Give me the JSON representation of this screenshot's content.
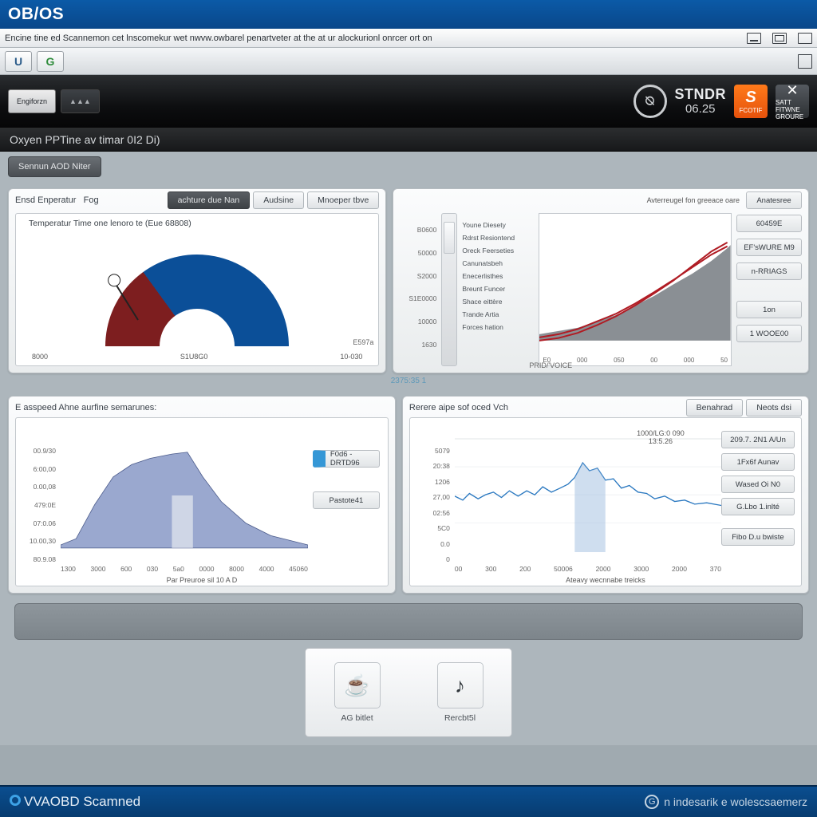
{
  "titlebar": {
    "title": "OB/OS"
  },
  "menubar": {
    "text": "Encine tine ed Scannemon cet lnscomekur wet nwvw.owbarel penartveter at the at ur alockurionl onrcer ort on"
  },
  "blackbar": {
    "btn1": "Engiforzn",
    "stndr_top": "STNDR",
    "stndr_bot": "06.25",
    "s_label": "FCOTIF",
    "x_label": "SATT FITWNE GROURE"
  },
  "subblack": {
    "text": "Oxyen PPTine av timar 0I2 Di)"
  },
  "chiprow": {
    "chip1": "Sennun AOD Niter"
  },
  "topleft": {
    "hdr_left": "Ensd Enperatur",
    "hdr_right": "Fog",
    "tab_dark": "achture due Nan",
    "tab1": "Audsine",
    "tab2": "Mnoeper tbve",
    "title": "Temperatur Time one lenoro te  (Eue 68808)",
    "x1": "8000",
    "x2": "S1U8G0",
    "x3": "10-030",
    "corner": "E597a"
  },
  "topright": {
    "hdr_caption": "Avterreugel fon greeace oare",
    "y": [
      "B0600",
      "50000",
      "S2000",
      "S1E0000",
      "10000",
      "1630"
    ],
    "legend": [
      "Youne Diesety",
      "Rdrst Resiontend",
      "Oreck Feerseties",
      "Canunatsbeh",
      "Enecerlisthes",
      "Breunt Funcer",
      "Shace eittère",
      "Trande Artia",
      "Forces hation"
    ],
    "x": [
      "E0",
      "000",
      "050",
      "00",
      "000",
      "50"
    ],
    "xlabel": "PRID/'VOICE",
    "btn_annot": "Anatesree",
    "side": [
      "60459E",
      "EF'sWURE M9",
      "n-RRIAGS",
      "1on",
      "1 WOOE00"
    ]
  },
  "divider": {
    "label": "2375:35 1"
  },
  "botleft": {
    "title": "E asspeed Ahne aurfine semarunes:",
    "y": [
      "00.9/30",
      "6:00,00",
      "0.00,08",
      "479:0E",
      "07:0.06",
      "10.00,30",
      "80.9.08"
    ],
    "x": [
      "1300",
      "3000",
      "600",
      "030",
      "5a0",
      "0000",
      "8000",
      "4000",
      "45060"
    ],
    "xlabel": "Par Preuroe sil 10 A D",
    "side1": "F0d6 - DRTD96",
    "side2": "Pastote41"
  },
  "botright": {
    "title": "Rerere aipe sof oced Vch",
    "annot1": "1000/LG:0 090",
    "annot2": "13:5.26",
    "y": [
      "5079",
      "20:38",
      "1206",
      "27,00",
      "02:56",
      "5C0",
      "0.0",
      "0"
    ],
    "x": [
      "00",
      "300",
      "200",
      "50006",
      "2000",
      "3000",
      "2000",
      "370"
    ],
    "xlabel": "Ateavy wecnnabe treicks",
    "tab1": "Benahrad",
    "tab2": "Neots dsi",
    "side": [
      "209.7. 2N1 A/Un",
      "1Fx6f  Aunav",
      "Wased Oi N0",
      "G.Lbo  1.inlté",
      "Fibo D.u  bwiste"
    ]
  },
  "btmcard": {
    "l1": "AG bitlet",
    "l2": "Rercbt5l"
  },
  "footer": {
    "left": "VVAOBD Scamned",
    "right": "n indesarik e wolescsaemerz"
  },
  "chart_data": [
    {
      "type": "pie",
      "title": "Temperatur Time one lenoro te  (Eue 68808)",
      "categories": [
        "8000",
        "S1U8G0",
        "10-030"
      ],
      "note": "semi-circular gauge; approximate sector shares",
      "values": [
        30,
        86,
        24
      ]
    },
    {
      "type": "area",
      "title": "right-top growth chart",
      "x": [
        0,
        30,
        60,
        90,
        120,
        150,
        180,
        210,
        240,
        270,
        290
      ],
      "series": [
        {
          "name": "grey-area",
          "values": [
            140,
            135,
            130,
            120,
            110,
            95,
            80,
            62,
            45,
            25,
            5
          ]
        },
        {
          "name": "red-line-1",
          "values": [
            145,
            140,
            132,
            120,
            108,
            92,
            74,
            55,
            35,
            15,
            2
          ]
        },
        {
          "name": "red-line-2",
          "values": [
            150,
            146,
            138,
            126,
            112,
            95,
            76,
            56,
            33,
            10,
            0
          ]
        }
      ],
      "ylim": [
        0,
        150
      ]
    },
    {
      "type": "area",
      "title": "E asspeed Ahne aurfine semarunes:",
      "x": [
        0,
        40,
        80,
        120,
        160,
        200,
        240,
        280,
        320,
        360,
        400
      ],
      "values": [
        5,
        12,
        40,
        70,
        88,
        95,
        100,
        72,
        48,
        26,
        8
      ],
      "ylim": [
        0,
        100
      ]
    },
    {
      "type": "line",
      "title": "Rerere aipe sof oced Vch",
      "x": [
        0,
        30,
        60,
        90,
        120,
        150,
        180,
        210,
        240,
        270,
        300,
        330,
        360,
        390
      ],
      "values": [
        52,
        49,
        55,
        50,
        53,
        58,
        54,
        60,
        78,
        70,
        56,
        50,
        47,
        44
      ],
      "ylim": [
        0,
        100
      ]
    }
  ]
}
